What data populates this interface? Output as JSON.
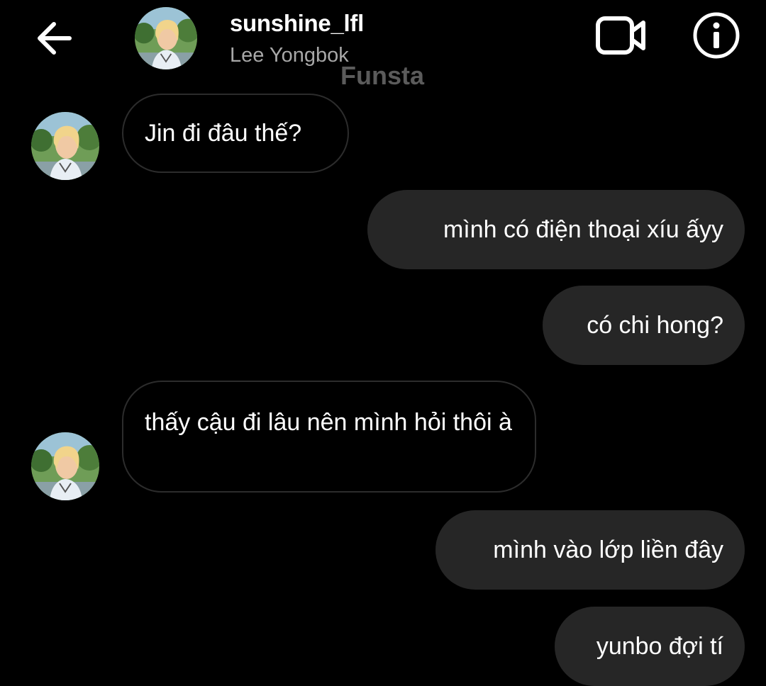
{
  "header": {
    "back_icon": "arrow-left-icon",
    "username": "sunshine_lfl",
    "display_name": "Lee Yongbok",
    "watermark": "Funsta",
    "video_icon": "video-camera-icon",
    "info_icon": "info-circle-icon"
  },
  "messages": [
    {
      "direction": "received",
      "text": "Jin đi đâu thế?"
    },
    {
      "direction": "sent",
      "text": "mình có điện thoại xíu ấyy"
    },
    {
      "direction": "sent",
      "text": "có chi hong?"
    },
    {
      "direction": "received",
      "text": "thấy cậu đi lâu nên mình hỏi thôi à"
    },
    {
      "direction": "sent",
      "text": "mình vào lớp liền đây"
    },
    {
      "direction": "sent",
      "text": "yunbo đợi tí"
    }
  ],
  "colors": {
    "background": "#000000",
    "sent_bubble": "#262626",
    "received_bubble_border": "#2c2c2c",
    "secondary_text": "#a8a8a8",
    "watermark": "#5b5b5b"
  }
}
